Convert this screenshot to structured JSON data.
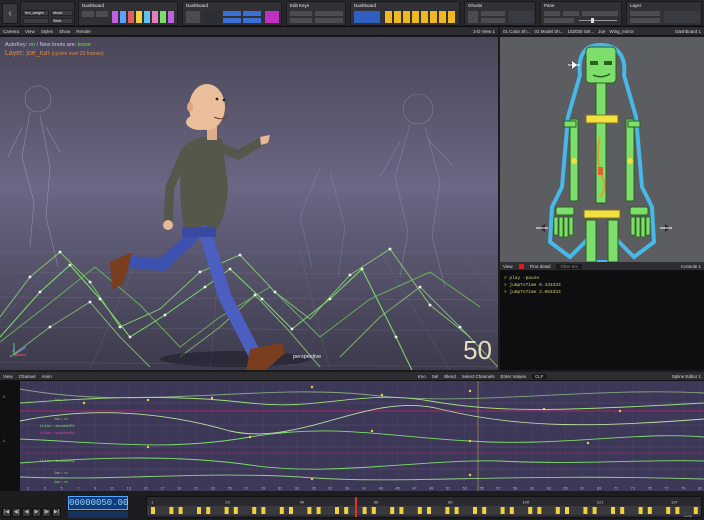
{
  "toolbar": {
    "groups": [
      {
        "title": "",
        "field_left": "frm_weight",
        "field_right": "Mode",
        "extra": "Slide"
      },
      {
        "title": "Dashboard"
      },
      {
        "title": "Dashboard"
      },
      {
        "title": "Edit Keys"
      },
      {
        "title": "Dashboard"
      },
      {
        "title": "Ghosts"
      },
      {
        "title": "Pane"
      },
      {
        "title": "Layer"
      }
    ]
  },
  "viewport_header": {
    "items": [
      "Camera",
      "View",
      "Styles",
      "Show",
      "Render"
    ],
    "right": "3-D View 1"
  },
  "viewport": {
    "hud_autokey_prefix": "AutoKey:",
    "hud_autokey_state": "on",
    "hud_newknots_prefix": "/ New knots are:",
    "hud_newknots_state": "loose",
    "hud_layer": "Layer: joe_run",
    "hud_layer_note": "(cycles over 20 frames)",
    "frame_number": "50",
    "camera_label": "perspective",
    "axis_label": "Z"
  },
  "sheet_header": {
    "tabs": [
      "01 Color Sh...",
      "01 Model Sh...",
      "102030 Sel...",
      "Joe",
      "Wing_mirror",
      "Dashboard 1"
    ]
  },
  "console_header": {
    "items": [
      "View"
    ],
    "checkbox_label": "Fine detail",
    "field": "Filter tex",
    "right": "Console 1"
  },
  "console": {
    "lines": [
      "> play -pause",
      "> jumpToTime 0.433333",
      "> jumpToTime 2.083333"
    ]
  },
  "spline_header": {
    "items": [
      "View",
      "Channel",
      "Anim"
    ],
    "mid_labels": [
      "Kno",
      "Sel",
      "Blend",
      "Select Channels",
      "Enter Values"
    ],
    "right_field": "CLF",
    "right": "Spline Editor 1"
  },
  "spline": {
    "channel_labels": [
      {
        "text": "Joe  ::  Y",
        "color": "#7dde6b"
      },
      {
        "text": "Joe  ::  rx",
        "color": "#7dde6b"
      },
      {
        "text": "Lf.Arm  ::  shoulderRx",
        "color": "#7dde6b"
      },
      {
        "text": "Lf.Arm  ::  shoulderRz",
        "color": "#e04a96"
      },
      {
        "text": "Lf.Arm  ::  shoulderRy",
        "color": "#7dde6b"
      },
      {
        "text": "Joe  ::  rx",
        "color": "#7dde6b"
      },
      {
        "text": "Joe  ::  rz",
        "color": "#7dde6b"
      }
    ],
    "frame_ticks": [
      "1",
      "3",
      "5",
      "7",
      "9",
      "11",
      "13",
      "15",
      "17",
      "19",
      "21",
      "23",
      "25",
      "27",
      "29",
      "31",
      "33",
      "35",
      "37",
      "39",
      "41",
      "43",
      "45",
      "47",
      "49",
      "51",
      "53",
      "55",
      "57",
      "59",
      "61",
      "63",
      "65",
      "67",
      "69",
      "71",
      "73",
      "75",
      "77",
      "79",
      "81"
    ],
    "grid_ticks": [
      "-8",
      "-4"
    ]
  },
  "transport": {
    "buttons": [
      "rewind-start",
      "step-back",
      "play-back",
      "play",
      "step-forward",
      "rewind-end"
    ],
    "current_frame": "00000050.00",
    "dope_ticks": [
      "1",
      "23",
      "40",
      "60",
      "80",
      "100",
      "121",
      "137"
    ],
    "dope_end": "1405"
  },
  "colors": {
    "accent_blue": "#5ea2ff",
    "curve_green": "#7dde6b",
    "curve_pink": "#e04a96",
    "key_yellow": "#f0d23a"
  }
}
